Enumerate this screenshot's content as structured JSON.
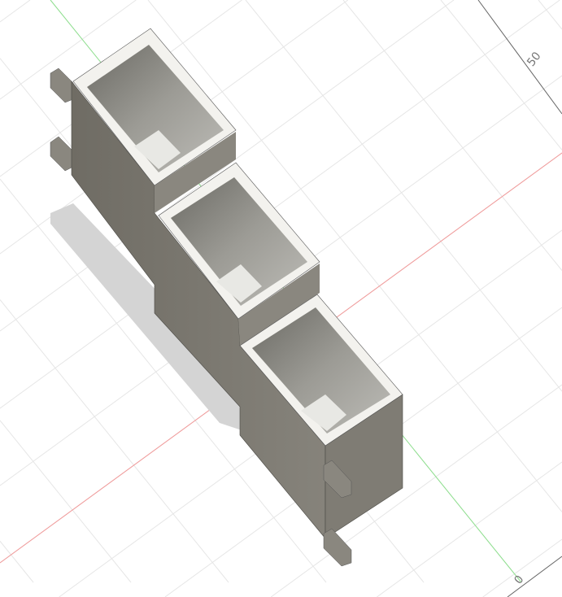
{
  "viewport": {
    "grid_labels": {
      "fifty": "50",
      "zero": "0"
    },
    "colors": {
      "x_axis": "#f08080",
      "y_axis": "#80e080",
      "body": "#7a776f",
      "rim": "#f4f3ef",
      "grid": "#e6e6e6"
    }
  }
}
